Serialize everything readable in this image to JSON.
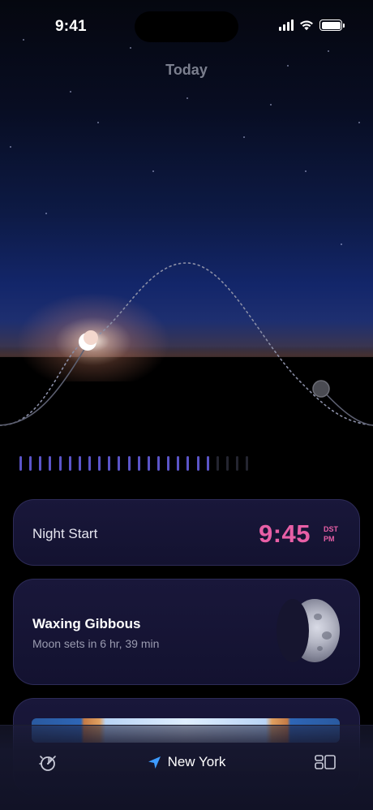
{
  "status_bar": {
    "time": "9:41"
  },
  "header": {
    "title": "Today"
  },
  "night_card": {
    "label": "Night Start",
    "time": "9:45",
    "zone": "DST",
    "meridiem": "PM"
  },
  "moon_card": {
    "phase": "Waxing Gibbous",
    "detail": "Moon sets in 6 hr, 39 min"
  },
  "timeline": {
    "active_ticks": 20,
    "total_ticks": 24
  },
  "tab_bar": {
    "location": "New York",
    "left_icon": "sun-dial-icon",
    "right_icon": "layout-icon",
    "location_icon": "location-arrow-icon"
  },
  "colors": {
    "accent_pink": "#e85fa6",
    "tick_active": "#5b55c8",
    "card_bg": "#17163a"
  }
}
